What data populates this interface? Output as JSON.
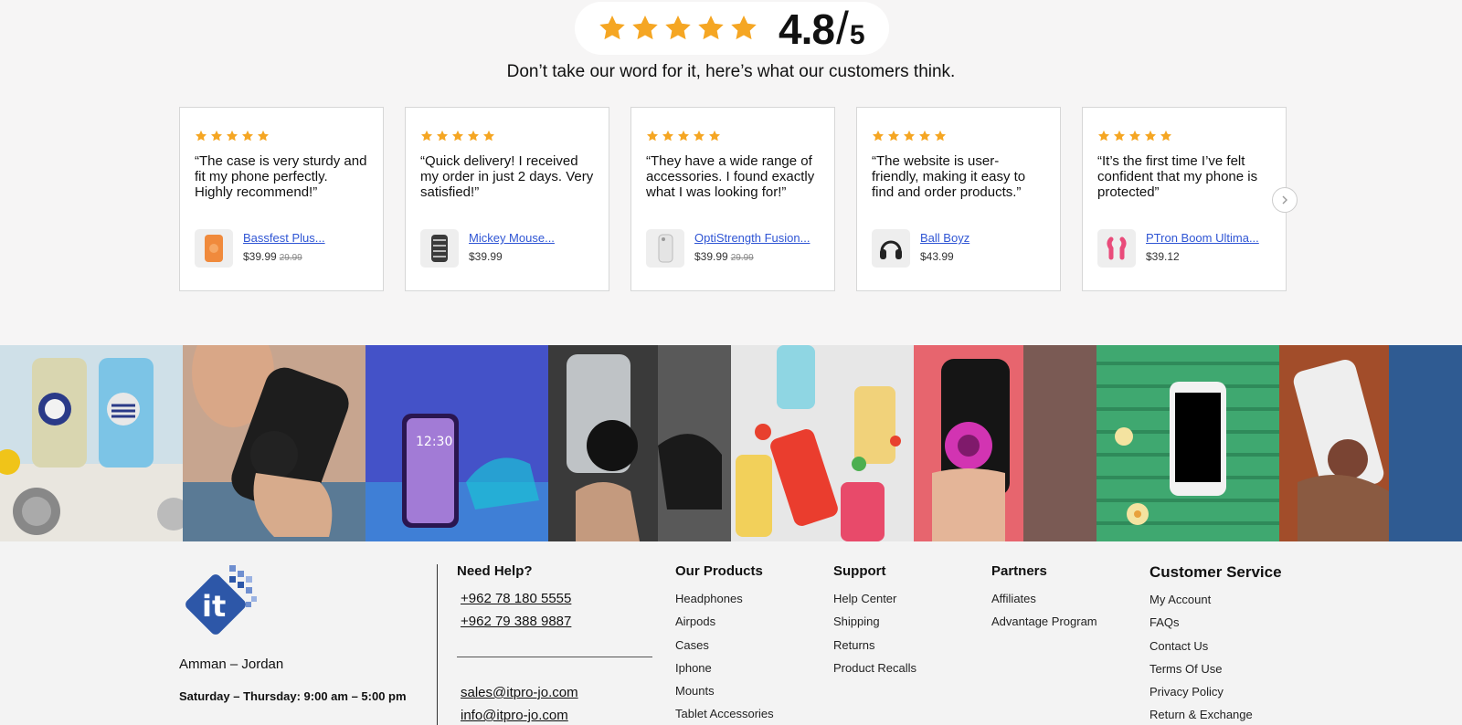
{
  "rating": {
    "stars": 5,
    "score": "4.8",
    "slash": "/",
    "out_of": "5"
  },
  "tagline": "Don’t take our word for it, here’s what our customers think.",
  "colors": {
    "star": "#f5a623",
    "link": "#2f55d4",
    "background": "#f6f5f5",
    "logo": "#2d57a8"
  },
  "reviews": [
    {
      "stars": 5,
      "quote": "“The case is very sturdy and fit my phone perfectly. Highly recommend!”",
      "product": "Bassfest Plus...",
      "price": "$39.99",
      "old_price": "29.99",
      "thumb": "orange-case"
    },
    {
      "stars": 5,
      "quote": "“Quick delivery! I received my order in just 2 days. Very satisfied!”",
      "product": "Mickey Mouse...",
      "price": "$39.99",
      "old_price": "",
      "thumb": "patterned-case"
    },
    {
      "stars": 5,
      "quote": "“They have a wide range of accessories. I found exactly what I was looking for!”",
      "product": "OptiStrength Fusion...",
      "price": "$39.99",
      "old_price": "29.99",
      "thumb": "clear-case"
    },
    {
      "stars": 5,
      "quote": "“The website is user-friendly, making it easy to find and order products.”",
      "product": "Ball Boyz",
      "price": "$43.99",
      "old_price": "",
      "thumb": "headphones"
    },
    {
      "stars": 5,
      "quote": "“It’s the first time I’ve felt confident that my phone is protected”",
      "product": "PTron Boom Ultima...",
      "price": "$39.12",
      "old_price": "",
      "thumb": "pink-earbuds"
    }
  ],
  "next_icon": "chevron-right-icon",
  "footer": {
    "city": "Amman – Jordan",
    "hours": "Saturday – Thursday: 9:00 am – 5:00 pm",
    "help": {
      "title": "Need Help?",
      "phones": [
        "+962 78 180 5555",
        "+962 79 388 9887"
      ],
      "emails": [
        "sales@itpro-jo.com",
        "info@itpro-jo.com"
      ]
    },
    "products": {
      "title": "Our Products",
      "items": [
        "Headphones",
        "Airpods",
        "Cases",
        "Iphone",
        "Mounts",
        "Tablet Accessories"
      ]
    },
    "support": {
      "title": "Support",
      "items": [
        "Help Center",
        "Shipping",
        "Returns",
        "Product Recalls"
      ]
    },
    "partners": {
      "title": "Partners",
      "items": [
        "Affiliates",
        "Advantage Program"
      ]
    },
    "customer_service": {
      "title": "Customer Service",
      "items": [
        "My Account",
        "FAQs",
        "Contact Us",
        "Terms Of Use",
        "Privacy Policy",
        "Return & Exchange"
      ]
    }
  }
}
